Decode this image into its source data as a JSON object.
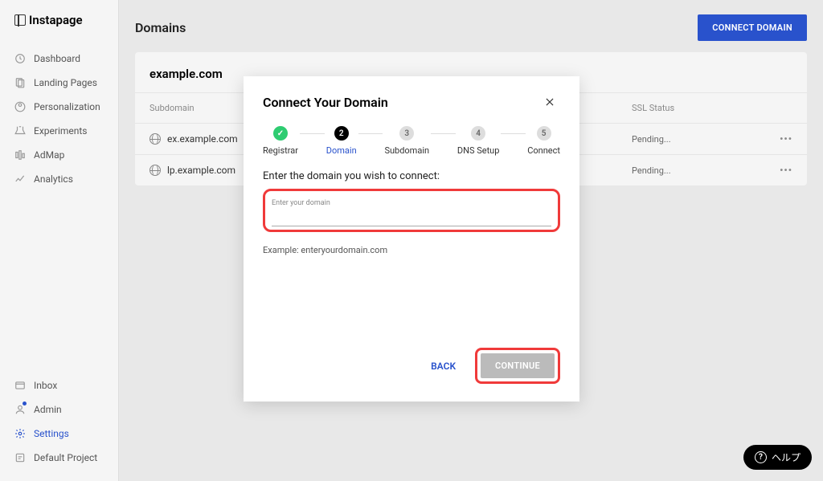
{
  "brand": "Instapage",
  "header": {
    "title": "Domains",
    "connect_btn": "CONNECT DOMAIN"
  },
  "sidebar": {
    "top": [
      {
        "label": "Dashboard",
        "icon": "dashboard-icon"
      },
      {
        "label": "Landing Pages",
        "icon": "pages-icon"
      },
      {
        "label": "Personalization",
        "icon": "personalization-icon"
      },
      {
        "label": "Experiments",
        "icon": "experiments-icon"
      },
      {
        "label": "AdMap",
        "icon": "admap-icon"
      },
      {
        "label": "Analytics",
        "icon": "analytics-icon"
      }
    ],
    "bottom": [
      {
        "label": "Inbox",
        "icon": "inbox-icon"
      },
      {
        "label": "Admin",
        "icon": "admin-icon",
        "notif": true
      },
      {
        "label": "Settings",
        "icon": "settings-icon",
        "active": true
      },
      {
        "label": "Default Project",
        "icon": "project-icon"
      }
    ]
  },
  "domain_panel": {
    "title": "example.com",
    "columns": {
      "subdomain": "Subdomain",
      "ssl": "SSL Status"
    },
    "rows": [
      {
        "subdomain": "ex.example.com",
        "ssl": "Pending..."
      },
      {
        "subdomain": "lp.example.com",
        "ssl": "Pending..."
      }
    ]
  },
  "modal": {
    "title": "Connect Your Domain",
    "steps": [
      {
        "label": "Registrar",
        "state": "done"
      },
      {
        "label": "Domain",
        "state": "active",
        "num": "2"
      },
      {
        "label": "Subdomain",
        "state": "pending",
        "num": "3"
      },
      {
        "label": "DNS Setup",
        "state": "pending",
        "num": "4"
      },
      {
        "label": "Connect",
        "state": "pending",
        "num": "5"
      }
    ],
    "instruction": "Enter the domain you wish to connect:",
    "input_label": "Enter your domain",
    "input_value": "",
    "example": "Example: enteryourdomain.com",
    "back_btn": "BACK",
    "continue_btn": "CONTINUE"
  },
  "help": {
    "label": "ヘルプ"
  }
}
